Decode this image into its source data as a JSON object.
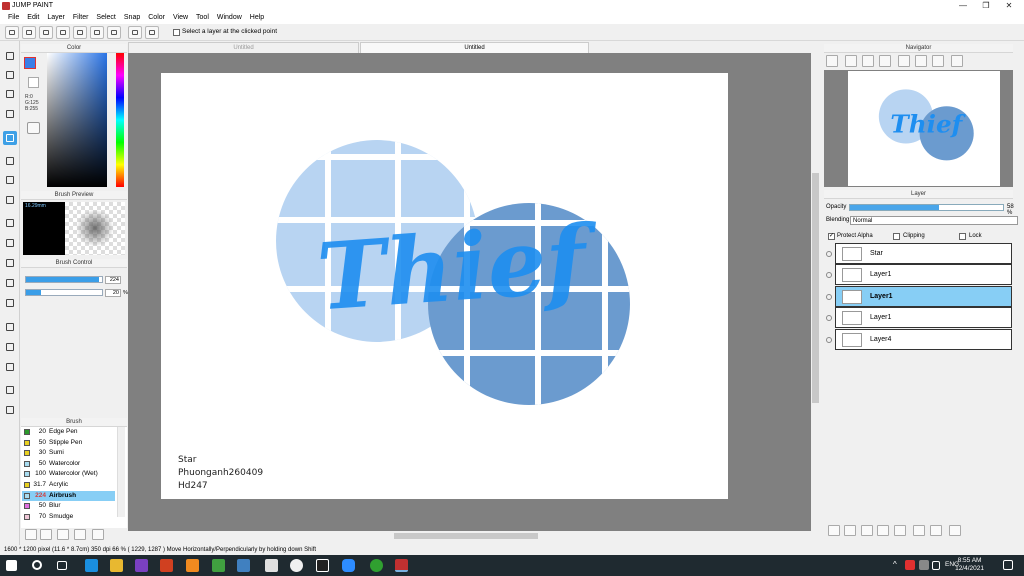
{
  "window": {
    "title": "JUMP PAINT"
  },
  "menu": [
    "File",
    "Edit",
    "Layer",
    "Filter",
    "Select",
    "Snap",
    "Color",
    "View",
    "Tool",
    "Window",
    "Help"
  ],
  "toolbar": {
    "select_layer_label": "Select a layer at the clicked point"
  },
  "color_panel": {
    "title": "Color",
    "r": "R:0",
    "g": "G:125",
    "b": "B:255",
    "fg_color": "#3a7ee8",
    "bg_color": "#ffffff"
  },
  "brush_preview": {
    "title": "Brush Preview",
    "size": "16.29mm"
  },
  "brush_control": {
    "title": "Brush Control",
    "size_value": "224",
    "size_fraction": 0.96,
    "density_value": "20",
    "density_unit": "%",
    "density_fraction": 0.2
  },
  "brush_list": {
    "title": "Brush",
    "items": [
      {
        "size": "20",
        "name": "Edge Pen",
        "color": "#2a9a2a"
      },
      {
        "size": "50",
        "name": "Stipple Pen",
        "color": "#e8d020"
      },
      {
        "size": "30",
        "name": "Sumi",
        "color": "#e8d020"
      },
      {
        "size": "50",
        "name": "Watercolor",
        "color": "#a8dcf0"
      },
      {
        "size": "100",
        "name": "Watercolor (Wet)",
        "color": "#a8dcf0"
      },
      {
        "size": "31.7",
        "name": "Acrylic",
        "color": "#e8d020"
      },
      {
        "size": "224",
        "name": "Airbrush",
        "color": "#a8dcf0",
        "selected": true
      },
      {
        "size": "50",
        "name": "Blur",
        "color": "#e070e0"
      },
      {
        "size": "70",
        "name": "Smudge",
        "color": "#f0c8d8"
      }
    ]
  },
  "tabs": [
    {
      "label": "Untitled",
      "active": false
    },
    {
      "label": "Untitled",
      "active": true
    }
  ],
  "canvas": {
    "artwork_text": "Thief",
    "credits": [
      "Star",
      "Phuonganh260409",
      "Hd247"
    ]
  },
  "navigator": {
    "title": "Navigator"
  },
  "layer_panel": {
    "title": "Layer",
    "opacity_label": "Opacity",
    "opacity_value": "58",
    "opacity_unit": "%",
    "opacity_fraction": 0.58,
    "blending_label": "Blending",
    "blending_value": "Normal",
    "protect_alpha": "Protect Alpha",
    "clipping": "Clipping",
    "lock": "Lock",
    "layers": [
      {
        "name": "Star",
        "selected": false
      },
      {
        "name": "Layer1",
        "selected": false
      },
      {
        "name": "Layer1",
        "selected": true
      },
      {
        "name": "Layer1",
        "selected": false
      },
      {
        "name": "Layer4",
        "selected": false
      }
    ]
  },
  "status": {
    "text": "1600 * 1200 pixel  (11.6 * 8.7cm)  350 dpi  66 %  ( 1229, 1287 )  Move Horizontally/Perpendicularly by holding down Shift"
  },
  "taskbar": {
    "language": "ENG",
    "time": "8:55 AM",
    "date": "12/4/2021"
  },
  "colors": {
    "light_circle": "#b8d4f2",
    "dark_circle": "#6b9bcf",
    "lettering": "#1e8ef0",
    "accent": "#3ea0e6"
  }
}
